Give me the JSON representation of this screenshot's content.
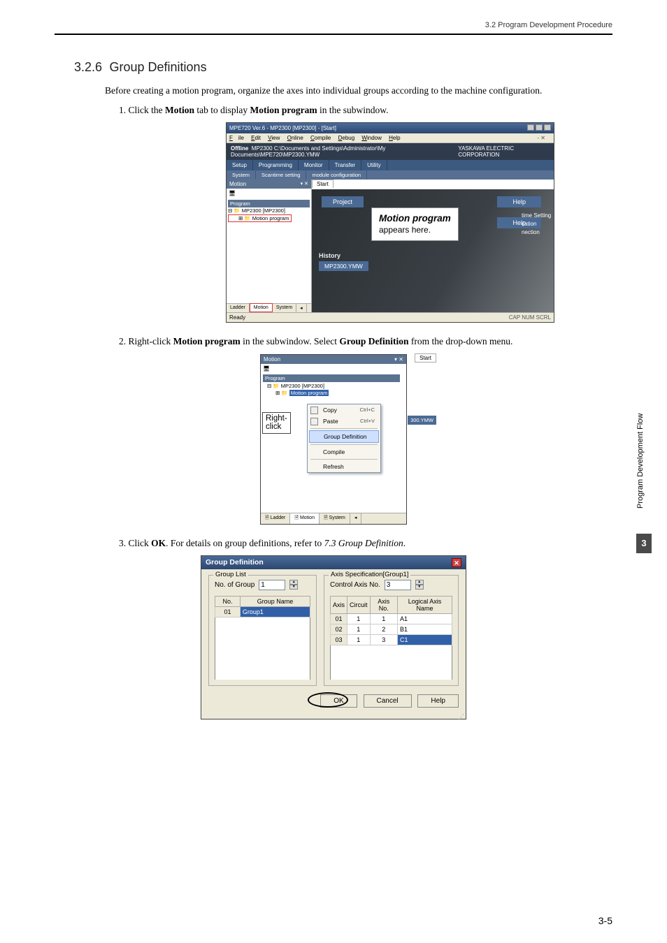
{
  "header": {
    "section_path": "3.2  Program Development Procedure"
  },
  "heading": {
    "num": "3.2.6",
    "title": "Group Definitions"
  },
  "intro": "Before creating a motion program, organize the axes into individual groups according to the machine configuration.",
  "step1": {
    "pre": "1. Click the ",
    "b1": "Motion",
    "mid": " tab to display ",
    "b2": "Motion program",
    "post": " in the subwindow."
  },
  "step2": {
    "pre": "2. Right-click ",
    "b1": "Motion program",
    "mid": " in the subwindow. Select ",
    "b2": "Group Definition",
    "post": " from the drop-down menu."
  },
  "step3": {
    "pre": "3. Click ",
    "b1": "OK",
    "mid": ". For details on group definitions, refer to ",
    "i1": "7.3 Group Definition",
    "post": "."
  },
  "ide": {
    "title": "MPE720 Ver.6 - MP2300 [MP2300] - [Start]",
    "menu": {
      "file": "File",
      "edit": "Edit",
      "view": "View",
      "online": "Online",
      "compile": "Compile",
      "debug": "Debug",
      "window": "Window",
      "help": "Help",
      "menuright": "- ✕"
    },
    "path_label": "Offline",
    "path": "MP2300 C:\\Documents and Settings\\Administrator\\My Documents\\MPE720\\MP2300.YMW",
    "brand": "YASKAWA ELECTRIC CORPORATION",
    "tabs": {
      "setup": "Setup",
      "programming": "Programming",
      "monitor": "Monitor",
      "transfer": "Transfer",
      "utility": "Utility"
    },
    "subtabs": {
      "system": "System",
      "scantime": "Scantime setting",
      "module": "module configuration"
    },
    "side": {
      "title": "Motion",
      "pin": "▾ ✕",
      "program_label": "Program",
      "node1": "MP2300 [MP2300]",
      "node2": "Motion program",
      "bottom_tabs": {
        "ladder": "Ladder",
        "motion": "Motion",
        "system": "System"
      }
    },
    "start_tab": "Start",
    "project_btn": "Project",
    "help_btn": "Help",
    "help_btn2": "Help",
    "callout_title": "Motion program",
    "callout_sub": "appears here.",
    "start_col": {
      "a": "time Setting",
      "b": "cation",
      "c": "nection"
    },
    "history_label": "History",
    "history_item": "MP2300.YMW",
    "status_left": "Ready",
    "status_right": "CAP  NUM  SCRL"
  },
  "panel2": {
    "title": "Motion",
    "pin": "▾ ✕",
    "start_tab": "Start",
    "program_label": "Program",
    "node1": "MP2300 [MP2300]",
    "node2": "Motion program",
    "menu": {
      "copy": "Copy",
      "copy_sc": "Ctrl+C",
      "paste": "Paste",
      "paste_sc": "Ctrl+V",
      "groupdef": "Group Definition",
      "compile": "Compile",
      "refresh": "Refresh"
    },
    "callout1": "Right-",
    "callout2": "click",
    "ymw": "300.YMW",
    "bottom_tabs": {
      "ladder": "Ladder",
      "motion": "Motion",
      "system": "System"
    }
  },
  "dlg": {
    "title": "Group Definition",
    "group_list": "Group List",
    "no_of_group": "No. of Group",
    "no_of_group_val": "1",
    "group_left": {
      "h1": "No.",
      "h2": "Group Name",
      "r1_no": "01",
      "r1_name": "Group1"
    },
    "axis_spec": "Axis Specification[Group1]",
    "control_axis": "Control Axis No.",
    "control_axis_val": "3",
    "axis_head": {
      "a": "Axis",
      "b": "Circuit",
      "c": "Axis No.",
      "d": "Logical Axis Name"
    },
    "rows": [
      {
        "a": "01",
        "b": "1",
        "c": "1",
        "d": "A1"
      },
      {
        "a": "02",
        "b": "1",
        "c": "2",
        "d": "B1"
      },
      {
        "a": "03",
        "b": "1",
        "c": "3",
        "d": "C1"
      }
    ],
    "ok": "OK",
    "cancel": "Cancel",
    "help": "Help"
  },
  "margin": {
    "text": "Program Development Flow",
    "num": "3"
  },
  "footer": "3-5"
}
